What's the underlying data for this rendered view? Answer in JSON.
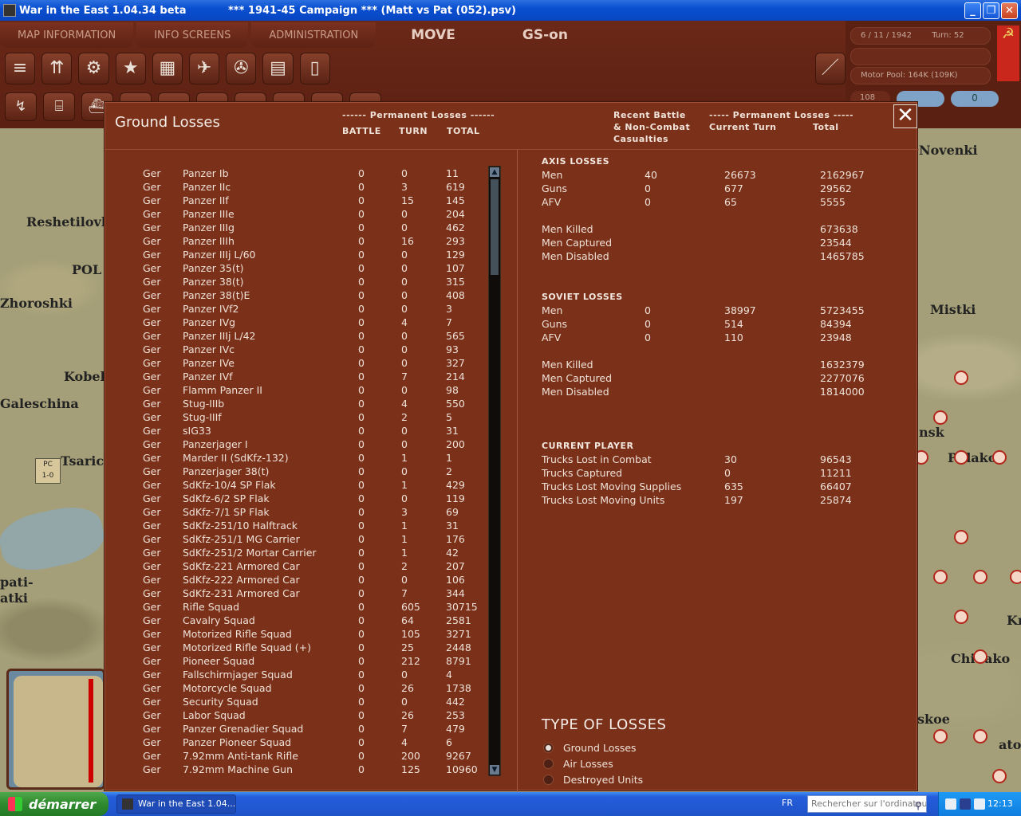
{
  "window": {
    "title_app": "War in the East 1.04.34 beta",
    "title_campaign": "***   1941-45 Campaign   ***   (Matt vs Pat (052).psv)",
    "btn_min": "_",
    "btn_max": "❐",
    "btn_close": "✕"
  },
  "menu": {
    "tabs": [
      "MAP INFORMATION",
      "INFO SCREENS",
      "ADMINISTRATION"
    ],
    "move": "MOVE",
    "gs": "GS-on"
  },
  "side": {
    "date": "6 / 11 / 1942",
    "turn": "Turn: 52",
    "motor_pool": "Motor Pool: 164K (109K)",
    "count": "108",
    "pill": "0"
  },
  "map": {
    "labels": [
      "Reshetilovka",
      "POL",
      "Zhoroshki",
      "Kobely",
      "Galeschina",
      "Tsarich",
      "pati-",
      "atki",
      "Novenki",
      "Mistki",
      "nsk",
      "Pidako",
      "Kr",
      "ChiSako",
      "skoe",
      "ato"
    ],
    "counter": "PC\n1-0"
  },
  "dialog": {
    "title": "Ground Losses",
    "hdr_perm_left": "------ Permanent Losses ------",
    "hdr_battle": "BATTLE",
    "hdr_turn": "TURN",
    "hdr_total": "TOTAL",
    "hdr_recent_1": "Recent Battle",
    "hdr_recent_2": "& Non-Combat",
    "hdr_recent_3": "Casualties",
    "hdr_perm_right": "----- Permanent Losses -----",
    "hdr_current_turn": "Current Turn",
    "hdr_total_right": "Total",
    "close": "✕"
  },
  "units": [
    [
      "Ger",
      "Panzer Ib",
      "0",
      "0",
      "11"
    ],
    [
      "Ger",
      "Panzer IIc",
      "0",
      "3",
      "619"
    ],
    [
      "Ger",
      "Panzer IIf",
      "0",
      "15",
      "145"
    ],
    [
      "Ger",
      "Panzer IIIe",
      "0",
      "0",
      "204"
    ],
    [
      "Ger",
      "Panzer IIIg",
      "0",
      "0",
      "462"
    ],
    [
      "Ger",
      "Panzer IIIh",
      "0",
      "16",
      "293"
    ],
    [
      "Ger",
      "Panzer IIIj L/60",
      "0",
      "0",
      "129"
    ],
    [
      "Ger",
      "Panzer 35(t)",
      "0",
      "0",
      "107"
    ],
    [
      "Ger",
      "Panzer 38(t)",
      "0",
      "0",
      "315"
    ],
    [
      "Ger",
      "Panzer 38(t)E",
      "0",
      "0",
      "408"
    ],
    [
      "Ger",
      "Panzer IVf2",
      "0",
      "0",
      "3"
    ],
    [
      "Ger",
      "Panzer IVg",
      "0",
      "4",
      "7"
    ],
    [
      "Ger",
      "Panzer IIIj L/42",
      "0",
      "0",
      "565"
    ],
    [
      "Ger",
      "Panzer IVc",
      "0",
      "0",
      "93"
    ],
    [
      "Ger",
      "Panzer IVe",
      "0",
      "0",
      "327"
    ],
    [
      "Ger",
      "Panzer IVf",
      "0",
      "7",
      "214"
    ],
    [
      "Ger",
      "Flamm Panzer II",
      "0",
      "0",
      "98"
    ],
    [
      "Ger",
      "Stug-IIIb",
      "0",
      "4",
      "550"
    ],
    [
      "Ger",
      "Stug-IIIf",
      "0",
      "2",
      "5"
    ],
    [
      "Ger",
      "sIG33",
      "0",
      "0",
      "31"
    ],
    [
      "Ger",
      "Panzerjager I",
      "0",
      "0",
      "200"
    ],
    [
      "Ger",
      "Marder II (SdKfz-132)",
      "0",
      "1",
      "1"
    ],
    [
      "Ger",
      "Panzerjager 38(t)",
      "0",
      "0",
      "2"
    ],
    [
      "Ger",
      "SdKfz-10/4 SP Flak",
      "0",
      "1",
      "429"
    ],
    [
      "Ger",
      "SdKfz-6/2 SP Flak",
      "0",
      "0",
      "119"
    ],
    [
      "Ger",
      "SdKfz-7/1 SP Flak",
      "0",
      "3",
      "69"
    ],
    [
      "Ger",
      "SdKfz-251/10 Halftrack",
      "0",
      "1",
      "31"
    ],
    [
      "Ger",
      "SdKfz-251/1 MG Carrier",
      "0",
      "1",
      "176"
    ],
    [
      "Ger",
      "SdKfz-251/2 Mortar Carrier",
      "0",
      "1",
      "42"
    ],
    [
      "Ger",
      "SdKfz-221 Armored Car",
      "0",
      "2",
      "207"
    ],
    [
      "Ger",
      "SdKfz-222 Armored Car",
      "0",
      "0",
      "106"
    ],
    [
      "Ger",
      "SdKfz-231 Armored Car",
      "0",
      "7",
      "344"
    ],
    [
      "Ger",
      "Rifle Squad",
      "0",
      "605",
      "30715"
    ],
    [
      "Ger",
      "Cavalry Squad",
      "0",
      "64",
      "2581"
    ],
    [
      "Ger",
      "Motorized Rifle Squad",
      "0",
      "105",
      "3271"
    ],
    [
      "Ger",
      "Motorized Rifle Squad (+)",
      "0",
      "25",
      "2448"
    ],
    [
      "Ger",
      "Pioneer Squad",
      "0",
      "212",
      "8791"
    ],
    [
      "Ger",
      "Fallschirmjager Squad",
      "0",
      "0",
      "4"
    ],
    [
      "Ger",
      "Motorcycle Squad",
      "0",
      "26",
      "1738"
    ],
    [
      "Ger",
      "Security Squad",
      "0",
      "0",
      "442"
    ],
    [
      "Ger",
      "Labor Squad",
      "0",
      "26",
      "253"
    ],
    [
      "Ger",
      "Panzer Grenadier Squad",
      "0",
      "7",
      "479"
    ],
    [
      "Ger",
      "Panzer Pioneer Squad",
      "0",
      "4",
      "6"
    ],
    [
      "Ger",
      "7.92mm Anti-tank Rifle",
      "0",
      "200",
      "9267"
    ],
    [
      "Ger",
      "7.92mm Machine Gun",
      "0",
      "125",
      "10960"
    ]
  ],
  "axis": {
    "title": "AXIS LOSSES",
    "rows": [
      [
        "Men",
        "40",
        "26673",
        "2162967"
      ],
      [
        "Guns",
        "0",
        "677",
        "29562"
      ],
      [
        "AFV",
        "0",
        "65",
        "5555"
      ]
    ],
    "detail": [
      [
        "Men Killed",
        "673638"
      ],
      [
        "Men Captured",
        "23544"
      ],
      [
        "Men Disabled",
        "1465785"
      ]
    ]
  },
  "soviet": {
    "title": "SOVIET LOSSES",
    "rows": [
      [
        "Men",
        "0",
        "38997",
        "5723455"
      ],
      [
        "Guns",
        "0",
        "514",
        "84394"
      ],
      [
        "AFV",
        "0",
        "110",
        "23948"
      ]
    ],
    "detail": [
      [
        "Men Killed",
        "1632379"
      ],
      [
        "Men Captured",
        "2277076"
      ],
      [
        "Men Disabled",
        "1814000"
      ]
    ]
  },
  "player": {
    "title": "CURRENT PLAYER",
    "rows": [
      [
        "Trucks Lost in Combat",
        "30",
        "96543"
      ],
      [
        "Trucks Captured",
        "0",
        "11211"
      ],
      [
        "Trucks Lost Moving Supplies",
        "635",
        "66407"
      ],
      [
        "Trucks Lost Moving Units",
        "197",
        "25874"
      ]
    ]
  },
  "types": {
    "title": "TYPE OF LOSSES",
    "options": [
      "Ground Losses",
      "Air Losses",
      "Destroyed Units"
    ],
    "selected": 0
  },
  "taskbar": {
    "start": "démarrer",
    "item": "War in the East 1.04....",
    "lang": "FR",
    "search_placeholder": "Rechercher sur l'ordinateur",
    "clock": "12:13"
  }
}
